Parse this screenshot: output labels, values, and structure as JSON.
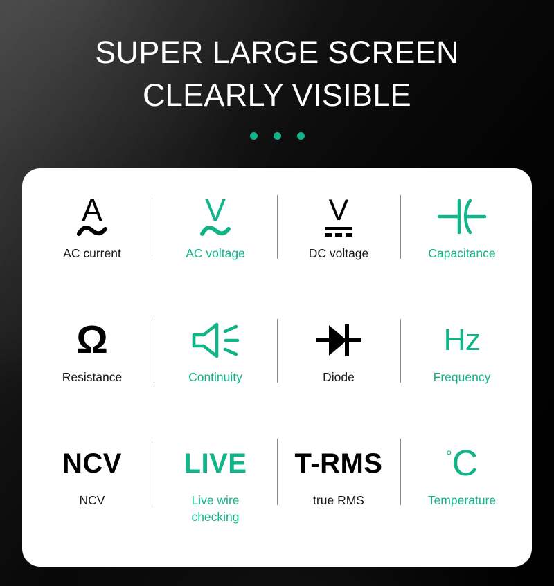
{
  "theme": {
    "accent_green": "#12b489",
    "background": "#000000",
    "card_background": "#ffffff",
    "text_dark": "#18181a",
    "divider": "#8a8a8a"
  },
  "header": {
    "title": "SUPER LARGE SCREEN\nCLEARLY VISIBLE",
    "title_line_1": "SUPER LARGE SCREEN",
    "title_line_2": "CLEARLY VISIBLE",
    "dots_count": 3
  },
  "features": {
    "rows": [
      [
        {
          "icon": "ac-current-icon",
          "symbol": "A",
          "label": "AC current",
          "color": "dark"
        },
        {
          "icon": "ac-voltage-icon",
          "symbol": "V",
          "label": "AC voltage",
          "color": "green"
        },
        {
          "icon": "dc-voltage-icon",
          "symbol": "V",
          "label": "DC voltage",
          "color": "dark"
        },
        {
          "icon": "capacitance-icon",
          "symbol": "",
          "label": "Capacitance",
          "color": "green"
        }
      ],
      [
        {
          "icon": "resistance-ohm-icon",
          "symbol": "Ω",
          "label": "Resistance",
          "color": "dark"
        },
        {
          "icon": "continuity-speaker-icon",
          "symbol": "",
          "label": "Continuity",
          "color": "green"
        },
        {
          "icon": "diode-icon",
          "symbol": "",
          "label": "Diode",
          "color": "dark"
        },
        {
          "icon": "frequency-hz-icon",
          "symbol": "Hz",
          "label": "Frequency",
          "color": "green"
        }
      ],
      [
        {
          "icon": "ncv-icon",
          "symbol": "NCV",
          "label": "NCV",
          "color": "dark"
        },
        {
          "icon": "live-wire-icon",
          "symbol": "LIVE",
          "label": "Live wire\nchecking",
          "color": "green"
        },
        {
          "icon": "true-rms-icon",
          "symbol": "T-RMS",
          "label": "true RMS",
          "color": "dark"
        },
        {
          "icon": "temperature-icon",
          "symbol": "°C",
          "label": "Temperature",
          "color": "green"
        }
      ]
    ]
  }
}
